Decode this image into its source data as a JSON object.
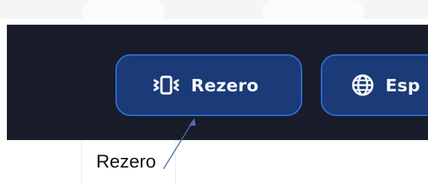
{
  "navbar": {
    "rezero_button": {
      "label": "Rezero",
      "icon": "vibrate-icon"
    },
    "language_button": {
      "label": "Esp",
      "icon": "globe-icon"
    }
  },
  "annotation": {
    "label": "Rezero"
  },
  "colors": {
    "navbar_bg": "#181c2b",
    "pill_bg": "#1b3a78",
    "pill_border": "#2f6fd8",
    "pill_text": "#f2f5fb",
    "pointer_line": "#4a6fb0"
  }
}
